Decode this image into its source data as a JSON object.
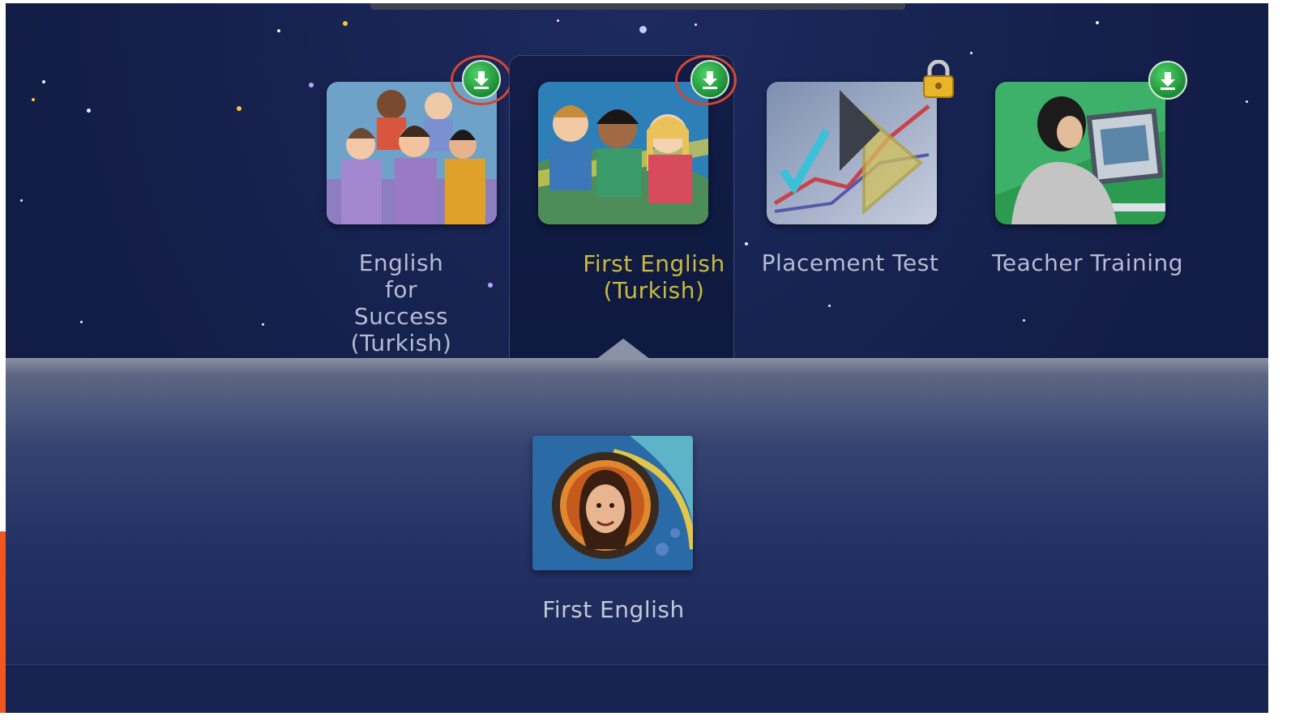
{
  "courses": [
    {
      "label": "English for Success (Turkish)",
      "status_icon": "download-icon",
      "highlighted": true,
      "selected": false
    },
    {
      "label": "First English (Turkish)",
      "status_icon": "download-icon",
      "highlighted": true,
      "selected": true
    },
    {
      "label": "Placement Test",
      "status_icon": "lock-icon",
      "highlighted": false,
      "selected": false
    },
    {
      "label": "Teacher Training",
      "status_icon": "download-icon",
      "highlighted": false,
      "selected": false
    }
  ],
  "sub_items": [
    {
      "label": "First English"
    }
  ],
  "colors": {
    "background": "#141f4a",
    "selected_text": "#c8bb3b",
    "normal_text": "#b6bcd2",
    "download_green": "#1b8d33",
    "highlight_ring": "#d9442f"
  }
}
